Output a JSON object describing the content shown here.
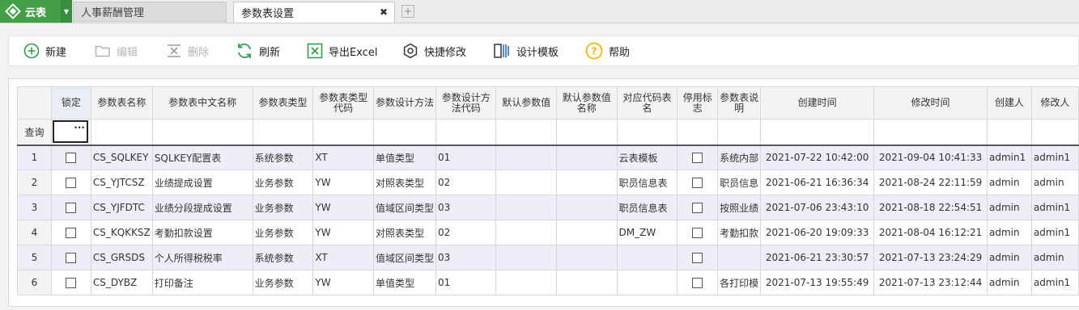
{
  "app": {
    "name": "云表"
  },
  "tabs": [
    {
      "label": "人事薪酬管理"
    },
    {
      "label": "参数表设置"
    }
  ],
  "toolbar": {
    "new_label": "新建",
    "edit_label": "编辑",
    "delete_label": "删除",
    "refresh_label": "刷新",
    "export_label": "导出Excel",
    "quick_label": "快捷修改",
    "design_label": "设计模板",
    "help_label": "帮助"
  },
  "grid": {
    "columns": [
      "锁定",
      "参数表名称",
      "参数表中文名称",
      "参数表类型",
      "参数表类型代码",
      "参数设计方法",
      "参数设计方法代码",
      "默认参数值",
      "默认参数值名称",
      "对应代码表名",
      "停用标志",
      "参数表说明",
      "创建时间",
      "修改时间",
      "创建人",
      "修改人"
    ],
    "query_label": "查询",
    "rows": [
      {
        "num": "1",
        "name": "CS_SQLKEY",
        "cname": "SQLKEY配置表",
        "type": "系统参数",
        "type_code": "XT",
        "method": "单值类型",
        "method_code": "01",
        "default_val": "",
        "default_name": "",
        "code_table": "云表模板",
        "desc": "系统内部",
        "created": "2021-07-22 10:42:00",
        "modified": "2021-09-04 10:41:33",
        "creator": "admin1",
        "modifier": "admin1"
      },
      {
        "num": "2",
        "name": "CS_YJTCSZ",
        "cname": "业绩提成设置",
        "type": "业务参数",
        "type_code": "YW",
        "method": "对照表类型",
        "method_code": "02",
        "default_val": "",
        "default_name": "",
        "code_table": "职员信息表",
        "desc": "职员信息",
        "created": "2021-06-21 16:36:34",
        "modified": "2021-08-24 22:11:59",
        "creator": "admin",
        "modifier": "admin"
      },
      {
        "num": "3",
        "name": "CS_YJFDTC",
        "cname": "业绩分段提成设置",
        "type": "业务参数",
        "type_code": "YW",
        "method": "值域区间类型",
        "method_code": "03",
        "default_val": "",
        "default_name": "",
        "code_table": "职员信息表",
        "desc": "按照业绩",
        "created": "2021-07-06 23:43:10",
        "modified": "2021-08-18 22:54:51",
        "creator": "admin",
        "modifier": "admin1"
      },
      {
        "num": "4",
        "name": "CS_KQKKSZ",
        "cname": "考勤扣款设置",
        "type": "业务参数",
        "type_code": "YW",
        "method": "对照表类型",
        "method_code": "02",
        "default_val": "",
        "default_name": "",
        "code_table": "DM_ZW",
        "desc": "考勤扣款",
        "created": "2021-06-20 19:09:33",
        "modified": "2021-08-04 16:12:21",
        "creator": "admin",
        "modifier": "admin1"
      },
      {
        "num": "5",
        "name": "CS_GRSDS",
        "cname": "个人所得税税率",
        "type": "系统参数",
        "type_code": "XT",
        "method": "值域区间类型",
        "method_code": "03",
        "default_val": "",
        "default_name": "",
        "code_table": "",
        "desc": "",
        "created": "2021-06-21 23:30:57",
        "modified": "2021-07-13 23:24:29",
        "creator": "admin",
        "modifier": "admin"
      },
      {
        "num": "6",
        "name": "CS_DYBZ",
        "cname": "打印备注",
        "type": "业务参数",
        "type_code": "YW",
        "method": "单值类型",
        "method_code": "01",
        "default_val": "",
        "default_name": "",
        "code_table": "",
        "desc": "各打印模",
        "created": "2021-07-13 19:55:49",
        "modified": "2021-07-13 23:12:44",
        "creator": "admin",
        "modifier": "admin1"
      }
    ]
  },
  "colors": {
    "brand_green": "#43a047",
    "row_alt": "#eeeef8",
    "icon_green": "#2e9d4f",
    "help_yellow": "#f2b705"
  }
}
